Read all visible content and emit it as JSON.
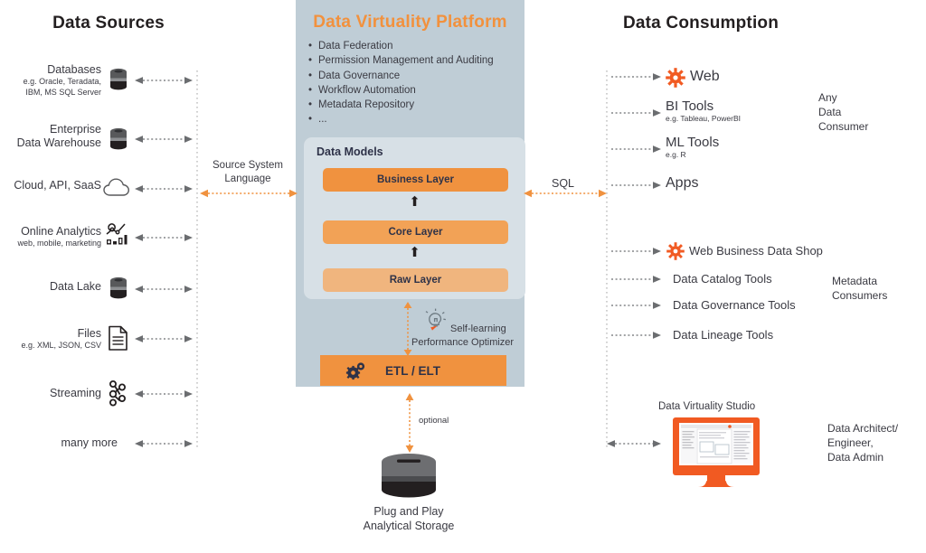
{
  "columns": {
    "left_title": "Data Sources",
    "center_title": "Data Virtuality Platform",
    "right_title": "Data Consumption"
  },
  "platform": {
    "features": [
      "Data Federation",
      "Permission Management and Auditing",
      "Data Governance",
      "Workflow Automation",
      "Metadata Repository",
      "..."
    ],
    "data_models_title": "Data Models",
    "layers": [
      {
        "label": "Business Layer",
        "color": "#f0923f"
      },
      {
        "label": "Core Layer",
        "color": "#f2a256"
      },
      {
        "label": "Raw Layer",
        "color": "#f0b57e"
      }
    ],
    "optimizer_label_line1": "Self-learning",
    "optimizer_label_line2": "Performance Optimizer",
    "etl_label": "ETL / ELT",
    "optional_label": "optional",
    "storage_label_line1": "Plug and Play",
    "storage_label_line2": "Analytical Storage"
  },
  "connectors": {
    "source_system_language_line1": "Source System",
    "source_system_language_line2": "Language",
    "sql_label": "SQL"
  },
  "sources": [
    {
      "name": "Databases",
      "sub": "e.g. Oracle, Teradata,\nIBM, MS SQL Server",
      "icon": "database-icon"
    },
    {
      "name": "Enterprise\nData Warehouse",
      "sub": "",
      "icon": "database-icon"
    },
    {
      "name": "Cloud, API, SaaS",
      "sub": "",
      "icon": "cloud-icon"
    },
    {
      "name": "Online Analytics",
      "sub": "web, mobile, marketing",
      "icon": "analytics-chart-icon"
    },
    {
      "name": "Data Lake",
      "sub": "",
      "icon": "database-icon"
    },
    {
      "name": "Files",
      "sub": "e.g. XML, JSON, CSV",
      "icon": "file-document-icon"
    },
    {
      "name": "Streaming",
      "sub": "",
      "icon": "streaming-nodes-icon"
    },
    {
      "name": "many more",
      "sub": "",
      "icon": "none"
    }
  ],
  "consumers_top": [
    {
      "name": "Web",
      "sub": "",
      "icon": "orange-gear-icon"
    },
    {
      "name": "BI Tools",
      "sub": "e.g. Tableau, PowerBI",
      "icon": "none"
    },
    {
      "name": "ML Tools",
      "sub": "e.g. R",
      "icon": "none"
    },
    {
      "name": "Apps",
      "sub": "",
      "icon": "none"
    }
  ],
  "consumers_bottom": [
    {
      "name": "Web Business Data Shop",
      "sub": "",
      "icon": "orange-gear-icon"
    },
    {
      "name": "Data Catalog Tools",
      "sub": "",
      "icon": "none"
    },
    {
      "name": "Data Governance Tools",
      "sub": "",
      "icon": "none"
    },
    {
      "name": "Data Lineage Tools",
      "sub": "",
      "icon": "none"
    }
  ],
  "groups": {
    "any_data_consumer": "Any\nData\nConsumer",
    "metadata_consumers": "Metadata\nConsumers",
    "data_architect": "Data Architect/\nEngineer,\nData Admin"
  },
  "studio": {
    "label": "Data Virtuality Studio"
  },
  "colors": {
    "brand_orange": "#f0923f",
    "studio_orange": "#f15a22",
    "panel_blue": "#bfcdd6",
    "inner_blue": "#d7e0e6",
    "text_dark": "#3a3a42",
    "layer_text": "#2e3248"
  }
}
